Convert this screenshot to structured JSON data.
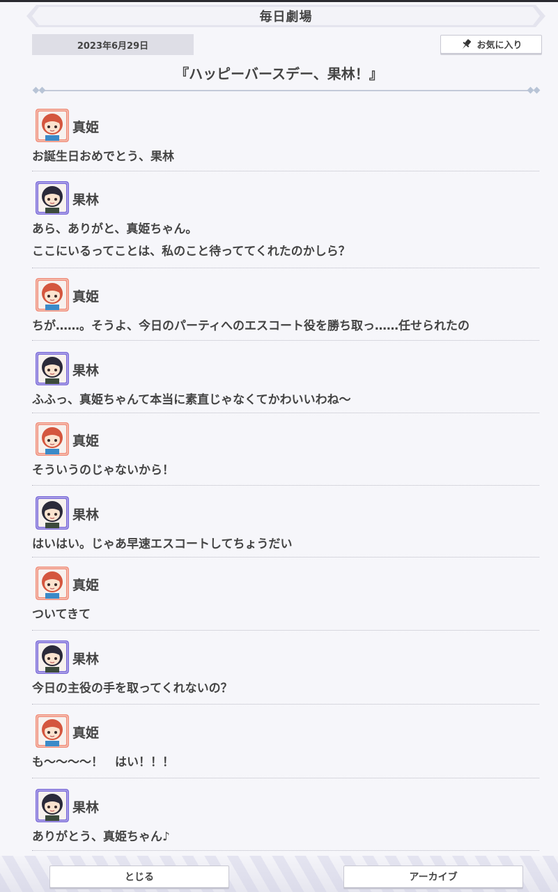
{
  "header": {
    "title": "毎日劇場"
  },
  "date": "2023年6月29日",
  "favorite_label": "お気に入り",
  "story_title": "『ハッピーバースデー、果林！』",
  "characters": {
    "maki": {
      "name": "真姫",
      "avatar_color": "#f08a78",
      "hair_color": "#d4563e"
    },
    "karin": {
      "name": "果林",
      "avatar_color": "#7a6ad8",
      "hair_color": "#2b2a3a"
    }
  },
  "messages": [
    {
      "speaker": "真姫",
      "avatar": "maki-avatar-icon",
      "lines": [
        "お誕生日おめでとう、果林"
      ]
    },
    {
      "speaker": "果林",
      "avatar": "karin-avatar-icon",
      "lines": [
        "あら、ありがと、真姫ちゃん。",
        "ここにいるってことは、私のこと待っててくれたのかしら？"
      ]
    },
    {
      "speaker": "真姫",
      "avatar": "maki-avatar-icon",
      "lines": [
        "ちが……。そうよ、今日のパーティへのエスコート役を勝ち取っ……任せられたの"
      ]
    },
    {
      "speaker": "果林",
      "avatar": "karin-avatar-icon",
      "lines": [
        "ふふっ、真姫ちゃんて本当に素直じゃなくてかわいいわね～"
      ]
    },
    {
      "speaker": "真姫",
      "avatar": "maki-avatar-icon",
      "lines": [
        "そういうのじゃないから！"
      ]
    },
    {
      "speaker": "果林",
      "avatar": "karin-avatar-icon",
      "lines": [
        "はいはい。じゃあ早速エスコートしてちょうだい"
      ]
    },
    {
      "speaker": "真姫",
      "avatar": "maki-avatar-icon",
      "lines": [
        "ついてきて"
      ]
    },
    {
      "speaker": "果林",
      "avatar": "karin-avatar-icon",
      "lines": [
        "今日の主役の手を取ってくれないの？"
      ]
    },
    {
      "speaker": "真姫",
      "avatar": "maki-avatar-icon",
      "lines": [
        "も～～～～！　はい！！！"
      ]
    },
    {
      "speaker": "果林",
      "avatar": "karin-avatar-icon",
      "lines": [
        "ありがとう、真姫ちゃん♪"
      ]
    }
  ],
  "footer": {
    "close_label": "とじる",
    "archive_label": "アーカイブ"
  }
}
